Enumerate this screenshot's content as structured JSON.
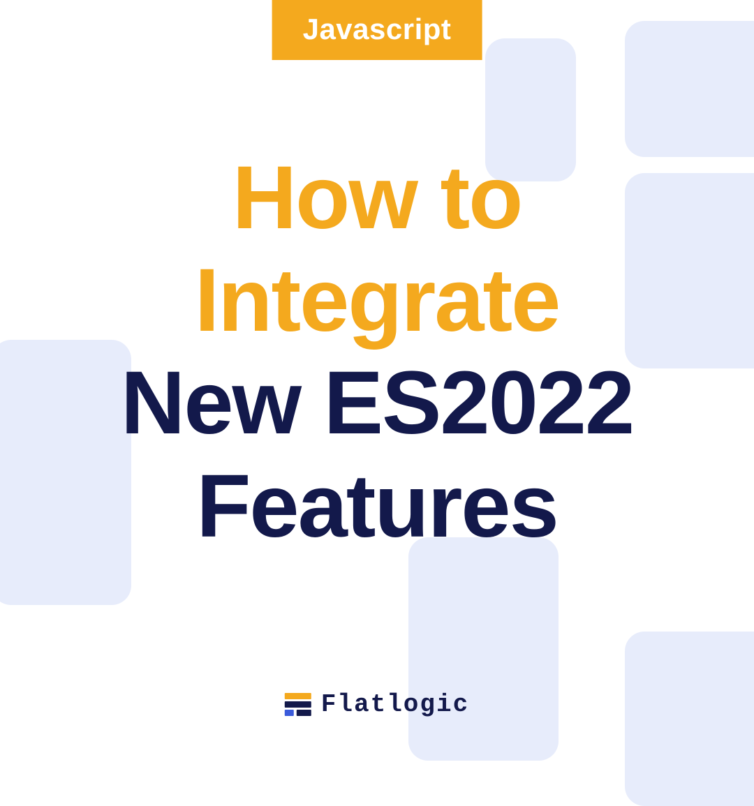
{
  "tag": "Javascript",
  "title": {
    "line1": "How to",
    "line2": "Integrate",
    "line3": "New ES2022",
    "line4": "Features"
  },
  "brand": {
    "name": "Flatlogic"
  },
  "colors": {
    "accent": "#f4a91e",
    "primary": "#13194b",
    "bgShape": "#e7ecfb"
  }
}
